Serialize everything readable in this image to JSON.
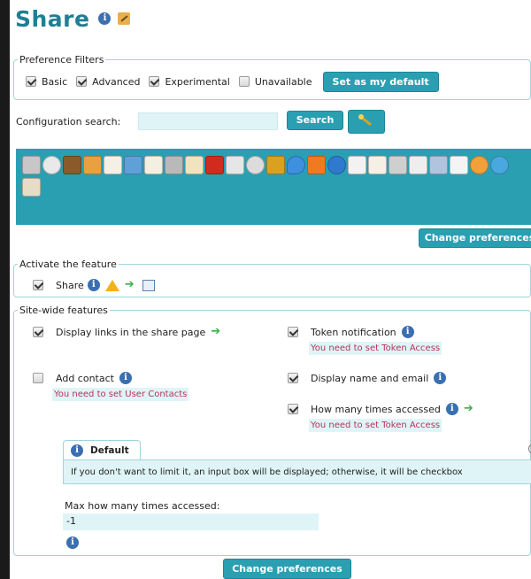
{
  "page": {
    "title": "Share"
  },
  "preference_filters": {
    "legend": "Preference Filters",
    "items": [
      {
        "label": "Basic",
        "checked": true
      },
      {
        "label": "Advanced",
        "checked": true
      },
      {
        "label": "Experimental",
        "checked": true
      },
      {
        "label": "Unavailable",
        "checked": false
      }
    ],
    "default_button": "Set as my default"
  },
  "config_search": {
    "label": "Configuration search:",
    "value": "",
    "search_button": "Search"
  },
  "toolbar": {
    "icons": [
      "tools-icon",
      "power-icon",
      "door-exit-icon",
      "users-icon",
      "document-scroll-icon",
      "image-gallery-icon",
      "edit-pencil-icon",
      "puzzle-icon",
      "id-card-icon",
      "flag-icon",
      "layout-icon",
      "stopwatch-icon",
      "key-icon",
      "comment-bubble-icon",
      "rss-icon",
      "globe-map-icon",
      "magnifier-icon",
      "report-icon",
      "package-icon",
      "book-icon",
      "people-icon",
      "window-icon",
      "clock-arrow-icon",
      "web-globe-icon",
      "contact-card-icon"
    ],
    "change_preferences": "Change preferences"
  },
  "activate": {
    "legend": "Activate the feature",
    "feature_label": "Share",
    "checked": true
  },
  "site_wide": {
    "legend": "Site-wide features",
    "options": {
      "display_links": {
        "label": "Display links in the share page",
        "checked": true
      },
      "token_notification": {
        "label": "Token notification",
        "checked": true,
        "warning": "You need to set Token Access"
      },
      "add_contact": {
        "label": "Add contact",
        "checked": false,
        "warning": "You need to set User Contacts"
      },
      "display_name_email": {
        "label": "Display name and email",
        "checked": true
      },
      "how_many_times": {
        "label": "How many times accessed",
        "checked": true,
        "warning": "You need to set Token Access"
      }
    },
    "default_tab": "Default",
    "default_message": "If you don't want to limit it, an input box will be displayed; otherwise, it will be checkbox",
    "max_label": "Max how many times accessed:",
    "max_value": "-1"
  },
  "bottom": {
    "change_preferences": "Change preferences"
  },
  "colors": {
    "accent": "#2a9fb2",
    "title": "#1f7f94",
    "warning_text": "#b8325b",
    "input_bg": "#dff4f6"
  }
}
